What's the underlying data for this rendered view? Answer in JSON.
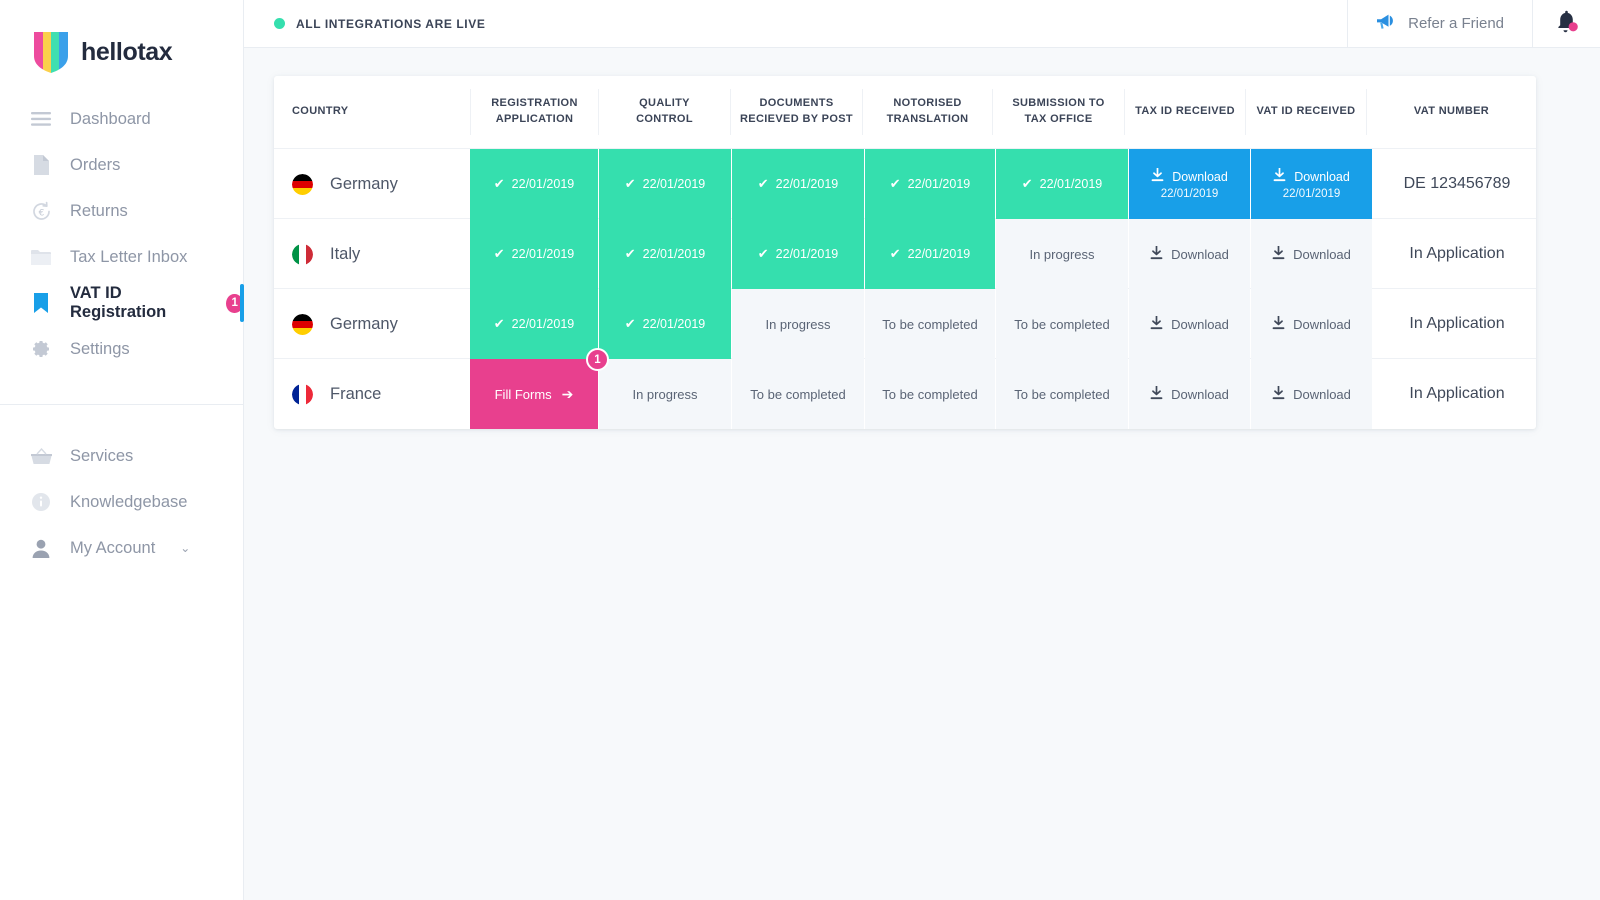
{
  "brand": {
    "name": "hellotax",
    "logo_colors": [
      "#ed4b9e",
      "#fbd04b",
      "#3fdfb0",
      "#3aa0ea"
    ],
    "accent_blue": "#189fe8",
    "accent_pink": "#e8408e",
    "accent_green": "#35dfae"
  },
  "sidebar": {
    "items": [
      {
        "label": "Dashboard",
        "icon": "menu-icon",
        "active": false,
        "badge": ""
      },
      {
        "label": "Orders",
        "icon": "document-icon",
        "active": false,
        "badge": ""
      },
      {
        "label": "Returns",
        "icon": "euro-refresh-icon",
        "active": false,
        "badge": ""
      },
      {
        "label": "Tax Letter Inbox",
        "icon": "folder-icon",
        "active": false,
        "badge": ""
      },
      {
        "label": "VAT ID Registration",
        "icon": "bookmark-icon",
        "active": true,
        "badge": "1"
      },
      {
        "label": "Settings",
        "icon": "gear-icon",
        "active": false,
        "badge": ""
      }
    ],
    "secondary_items": [
      {
        "label": "Services",
        "icon": "basket-icon"
      },
      {
        "label": "Knowledgebase",
        "icon": "info-icon"
      },
      {
        "label": "My Account",
        "icon": "user-icon",
        "chevron": "⌄"
      }
    ]
  },
  "topbar": {
    "status_text": "ALL INTEGRATIONS ARE LIVE",
    "status_color": "#35dfae",
    "refer_label": "Refer a Friend",
    "refer_icon": "megaphone-icon",
    "bell_icon": "bell-icon",
    "bell_has_badge": true
  },
  "table": {
    "columns": [
      "COUNTRY",
      "REGISTRATION APPLICATION",
      "QUALITY CONTROL",
      "DOCUMENTS RECIEVED BY POST",
      "NOTORISED TRANSLATION",
      "SUBMISSION TO TAX OFFICE",
      "TAX ID RECEIVED",
      "VAT ID RECEIVED",
      "VAT NUMBER"
    ],
    "columns_lines": [
      [
        "COUNTRY"
      ],
      [
        "REGISTRATION",
        "APPLICATION"
      ],
      [
        "QUALITY",
        "CONTROL"
      ],
      [
        "DOCUMENTS",
        "RECIEVED BY POST"
      ],
      [
        "NOTORISED",
        "TRANSLATION"
      ],
      [
        "SUBMISSION TO",
        "TAX OFFICE"
      ],
      [
        "TAX ID RECEIVED"
      ],
      [
        "VAT ID RECEIVED"
      ],
      [
        "VAT NUMBER"
      ]
    ],
    "labels": {
      "download": "Download",
      "in_progress": "In progress",
      "to_be_completed": "To be completed",
      "in_application": "In Application",
      "fill_forms": "Fill Forms",
      "check_glyph": "✔",
      "arrow_glyph": "➔"
    },
    "rows": [
      {
        "country": "Germany",
        "flag": "de-flag",
        "registration_application": {
          "state": "done",
          "text": "22/01/2019"
        },
        "quality_control": {
          "state": "done",
          "text": "22/01/2019"
        },
        "documents_recieved_by_post": {
          "state": "done",
          "text": "22/01/2019"
        },
        "notorised_translation": {
          "state": "done",
          "text": "22/01/2019"
        },
        "submission_to_tax_office": {
          "state": "done",
          "text": "22/01/2019"
        },
        "tax_id_received": {
          "state": "download-active",
          "text": "Download",
          "date": "22/01/2019"
        },
        "vat_id_received": {
          "state": "download-active",
          "text": "Download",
          "date": "22/01/2019"
        },
        "vat_number": "DE 123456789"
      },
      {
        "country": "Italy",
        "flag": "it-flag",
        "registration_application": {
          "state": "done",
          "text": "22/01/2019"
        },
        "quality_control": {
          "state": "done",
          "text": "22/01/2019"
        },
        "documents_recieved_by_post": {
          "state": "done",
          "text": "22/01/2019"
        },
        "notorised_translation": {
          "state": "done",
          "text": "22/01/2019"
        },
        "submission_to_tax_office": {
          "state": "idle",
          "text": "In progress"
        },
        "tax_id_received": {
          "state": "download-idle",
          "text": "Download",
          "date": ""
        },
        "vat_id_received": {
          "state": "download-idle",
          "text": "Download",
          "date": ""
        },
        "vat_number": "In Application"
      },
      {
        "country": "Germany",
        "flag": "de-flag",
        "registration_application": {
          "state": "done",
          "text": "22/01/2019"
        },
        "quality_control": {
          "state": "done",
          "text": "22/01/2019"
        },
        "documents_recieved_by_post": {
          "state": "idle",
          "text": "In progress"
        },
        "notorised_translation": {
          "state": "idle",
          "text": "To be completed"
        },
        "submission_to_tax_office": {
          "state": "idle",
          "text": "To be completed"
        },
        "tax_id_received": {
          "state": "download-idle",
          "text": "Download",
          "date": ""
        },
        "vat_id_received": {
          "state": "download-idle",
          "text": "Download",
          "date": ""
        },
        "vat_number": "In Application"
      },
      {
        "country": "France",
        "flag": "fr-flag",
        "registration_application": {
          "state": "action",
          "text": "Fill Forms",
          "badge": "1"
        },
        "quality_control": {
          "state": "idle",
          "text": "In progress"
        },
        "documents_recieved_by_post": {
          "state": "idle",
          "text": "To be completed"
        },
        "notorised_translation": {
          "state": "idle",
          "text": "To be completed"
        },
        "submission_to_tax_office": {
          "state": "idle",
          "text": "To be completed"
        },
        "tax_id_received": {
          "state": "download-idle",
          "text": "Download",
          "date": ""
        },
        "vat_id_received": {
          "state": "download-idle",
          "text": "Download",
          "date": ""
        },
        "vat_number": "In Application"
      }
    ]
  }
}
